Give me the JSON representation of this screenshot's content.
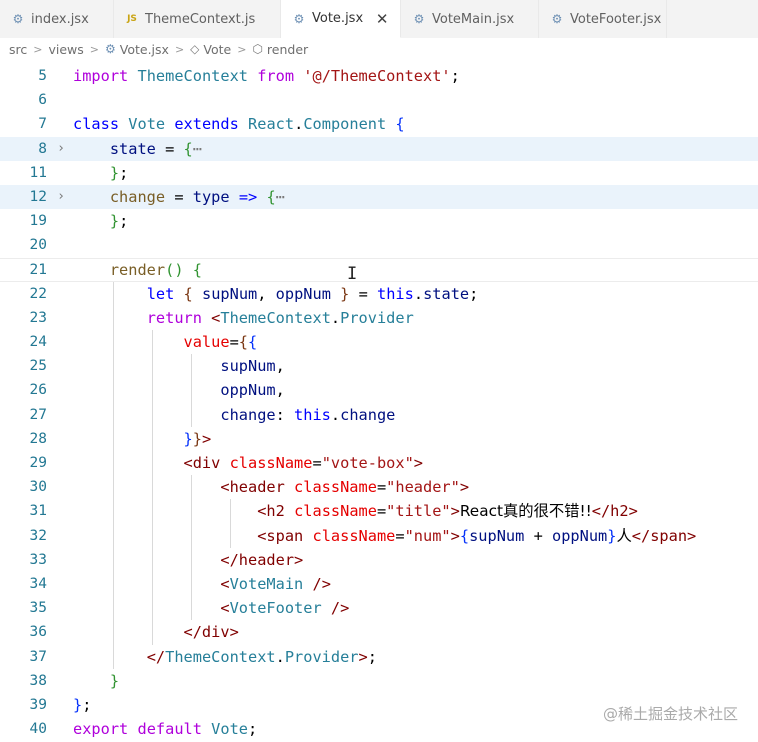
{
  "tabs": [
    {
      "label": "index.jsx",
      "icon": "gear-icon",
      "active": false
    },
    {
      "label": "ThemeContext.js",
      "icon": "js-file-icon",
      "active": false
    },
    {
      "label": "Vote.jsx",
      "icon": "gear-icon",
      "active": true
    },
    {
      "label": "VoteMain.jsx",
      "icon": "gear-icon",
      "active": false
    },
    {
      "label": "VoteFooter.jsx",
      "icon": "gear-icon",
      "active": false
    }
  ],
  "breadcrumb": {
    "src": "src",
    "views": "views",
    "file": "Vote.jsx",
    "class": "Vote",
    "method": "render"
  },
  "editor": {
    "lines": [
      {
        "num": "5",
        "fold": "",
        "tokens": [
          [
            "kw",
            "import"
          ],
          [
            "p",
            " "
          ],
          [
            "cls",
            "ThemeContext"
          ],
          [
            "p",
            " "
          ],
          [
            "kw",
            "from"
          ],
          [
            "p",
            " "
          ],
          [
            "str",
            "'@/ThemeContext'"
          ],
          [
            "p",
            ";"
          ]
        ]
      },
      {
        "num": "6",
        "fold": "",
        "tokens": []
      },
      {
        "num": "7",
        "fold": "",
        "tokens": [
          [
            "kw2",
            "class"
          ],
          [
            "p",
            " "
          ],
          [
            "cls",
            "Vote"
          ],
          [
            "p",
            " "
          ],
          [
            "kw2",
            "extends"
          ],
          [
            "p",
            " "
          ],
          [
            "cls",
            "React"
          ],
          [
            "p",
            "."
          ],
          [
            "cls",
            "Component"
          ],
          [
            "p",
            " "
          ],
          [
            "br1",
            "{"
          ]
        ]
      },
      {
        "num": "8",
        "fold": ">",
        "highlight": true,
        "tokens": [
          [
            "p",
            "    "
          ],
          [
            "var",
            "state"
          ],
          [
            "p",
            " = "
          ],
          [
            "br2",
            "{"
          ],
          [
            "ell",
            "⋯"
          ]
        ]
      },
      {
        "num": "11",
        "fold": "",
        "tokens": [
          [
            "p",
            "    "
          ],
          [
            "br2",
            "}"
          ],
          [
            "p",
            ";"
          ]
        ]
      },
      {
        "num": "12",
        "fold": ">",
        "highlight": true,
        "tokens": [
          [
            "p",
            "    "
          ],
          [
            "fn",
            "change"
          ],
          [
            "p",
            " = "
          ],
          [
            "var",
            "type"
          ],
          [
            "p",
            " "
          ],
          [
            "kw2",
            "=>"
          ],
          [
            "p",
            " "
          ],
          [
            "br2",
            "{"
          ],
          [
            "ell",
            "⋯"
          ]
        ]
      },
      {
        "num": "19",
        "fold": "",
        "tokens": [
          [
            "p",
            "    "
          ],
          [
            "br2",
            "}"
          ],
          [
            "p",
            ";"
          ]
        ]
      },
      {
        "num": "20",
        "fold": "",
        "tokens": []
      },
      {
        "num": "21",
        "fold": "",
        "current": true,
        "tokens": [
          [
            "p",
            "    "
          ],
          [
            "fn",
            "render"
          ],
          [
            "br2",
            "()"
          ],
          [
            "p",
            " "
          ],
          [
            "br2",
            "{"
          ]
        ]
      },
      {
        "num": "22",
        "fold": "",
        "tokens": [
          [
            "p",
            "        "
          ],
          [
            "kw2",
            "let"
          ],
          [
            "p",
            " "
          ],
          [
            "br3",
            "{"
          ],
          [
            "p",
            " "
          ],
          [
            "var",
            "supNum"
          ],
          [
            "p",
            ", "
          ],
          [
            "var",
            "oppNum"
          ],
          [
            "p",
            " "
          ],
          [
            "br3",
            "}"
          ],
          [
            "p",
            " = "
          ],
          [
            "kw2",
            "this"
          ],
          [
            "p",
            "."
          ],
          [
            "var",
            "state"
          ],
          [
            "p",
            ";"
          ]
        ]
      },
      {
        "num": "23",
        "fold": "",
        "tokens": [
          [
            "p",
            "        "
          ],
          [
            "kw",
            "return"
          ],
          [
            "p",
            " "
          ],
          [
            "tag",
            "<"
          ],
          [
            "cls",
            "ThemeContext"
          ],
          [
            "p",
            "."
          ],
          [
            "cls",
            "Provider"
          ]
        ]
      },
      {
        "num": "24",
        "fold": "",
        "tokens": [
          [
            "p",
            "            "
          ],
          [
            "attr",
            "value"
          ],
          [
            "p",
            "="
          ],
          [
            "br3",
            "{"
          ],
          [
            "br1",
            "{"
          ]
        ]
      },
      {
        "num": "25",
        "fold": "",
        "tokens": [
          [
            "p",
            "                "
          ],
          [
            "var",
            "supNum"
          ],
          [
            "p",
            ","
          ]
        ]
      },
      {
        "num": "26",
        "fold": "",
        "tokens": [
          [
            "p",
            "                "
          ],
          [
            "var",
            "oppNum"
          ],
          [
            "p",
            ","
          ]
        ]
      },
      {
        "num": "27",
        "fold": "",
        "tokens": [
          [
            "p",
            "                "
          ],
          [
            "var",
            "change"
          ],
          [
            "p",
            ": "
          ],
          [
            "kw2",
            "this"
          ],
          [
            "p",
            "."
          ],
          [
            "var",
            "change"
          ]
        ]
      },
      {
        "num": "28",
        "fold": "",
        "tokens": [
          [
            "p",
            "            "
          ],
          [
            "br1",
            "}"
          ],
          [
            "br3",
            "}"
          ],
          [
            "tag",
            ">"
          ]
        ]
      },
      {
        "num": "29",
        "fold": "",
        "tokens": [
          [
            "p",
            "            "
          ],
          [
            "tag",
            "<div"
          ],
          [
            "p",
            " "
          ],
          [
            "attr",
            "className"
          ],
          [
            "p",
            "="
          ],
          [
            "str",
            "\"vote-box\""
          ],
          [
            "tag",
            ">"
          ]
        ]
      },
      {
        "num": "30",
        "fold": "",
        "tokens": [
          [
            "p",
            "                "
          ],
          [
            "tag",
            "<header"
          ],
          [
            "p",
            " "
          ],
          [
            "attr",
            "className"
          ],
          [
            "p",
            "="
          ],
          [
            "str",
            "\"header\""
          ],
          [
            "tag",
            ">"
          ]
        ]
      },
      {
        "num": "31",
        "fold": "",
        "tokens": [
          [
            "p",
            "                    "
          ],
          [
            "tag",
            "<h2"
          ],
          [
            "p",
            " "
          ],
          [
            "attr",
            "className"
          ],
          [
            "p",
            "="
          ],
          [
            "str",
            "\"title\""
          ],
          [
            "tag",
            ">"
          ],
          [
            "txt",
            "React真的很不错!!"
          ],
          [
            "tag",
            "</h2>"
          ]
        ]
      },
      {
        "num": "32",
        "fold": "",
        "tokens": [
          [
            "p",
            "                    "
          ],
          [
            "tag",
            "<span"
          ],
          [
            "p",
            " "
          ],
          [
            "attr",
            "className"
          ],
          [
            "p",
            "="
          ],
          [
            "str",
            "\"num\""
          ],
          [
            "tag",
            ">"
          ],
          [
            "br1",
            "{"
          ],
          [
            "var",
            "supNum"
          ],
          [
            "p",
            " + "
          ],
          [
            "var",
            "oppNum"
          ],
          [
            "br1",
            "}"
          ],
          [
            "txt",
            "人"
          ],
          [
            "tag",
            "</span>"
          ]
        ]
      },
      {
        "num": "33",
        "fold": "",
        "tokens": [
          [
            "p",
            "                "
          ],
          [
            "tag",
            "</header>"
          ]
        ]
      },
      {
        "num": "34",
        "fold": "",
        "tokens": [
          [
            "p",
            "                "
          ],
          [
            "tag",
            "<"
          ],
          [
            "cls",
            "VoteMain"
          ],
          [
            "p",
            " "
          ],
          [
            "tag",
            "/>"
          ]
        ]
      },
      {
        "num": "35",
        "fold": "",
        "tokens": [
          [
            "p",
            "                "
          ],
          [
            "tag",
            "<"
          ],
          [
            "cls",
            "VoteFooter"
          ],
          [
            "p",
            " "
          ],
          [
            "tag",
            "/>"
          ]
        ]
      },
      {
        "num": "36",
        "fold": "",
        "tokens": [
          [
            "p",
            "            "
          ],
          [
            "tag",
            "</div>"
          ]
        ]
      },
      {
        "num": "37",
        "fold": "",
        "tokens": [
          [
            "p",
            "        "
          ],
          [
            "tag",
            "</"
          ],
          [
            "cls",
            "ThemeContext"
          ],
          [
            "p",
            "."
          ],
          [
            "cls",
            "Provider"
          ],
          [
            "tag",
            ">"
          ],
          [
            "p",
            ";"
          ]
        ]
      },
      {
        "num": "38",
        "fold": "",
        "tokens": [
          [
            "p",
            "    "
          ],
          [
            "br2",
            "}"
          ]
        ]
      },
      {
        "num": "39",
        "fold": "",
        "tokens": [
          [
            "br1",
            "}"
          ],
          [
            "p",
            ";"
          ]
        ]
      },
      {
        "num": "40",
        "fold": "",
        "tokens": [
          [
            "kw",
            "export"
          ],
          [
            "p",
            " "
          ],
          [
            "kw",
            "default"
          ],
          [
            "p",
            " "
          ],
          [
            "cls",
            "Vote"
          ],
          [
            "p",
            ";"
          ]
        ]
      }
    ]
  },
  "watermark": "@稀土掘金技术社区",
  "colors": {
    "line_number": "#237893",
    "keyword_control": "#af00db",
    "keyword": "#0000ff",
    "class_name": "#267f99",
    "variable": "#001080",
    "function": "#795e26",
    "string": "#a31515",
    "tag": "#800000",
    "attribute": "#e50000",
    "folded_line_highlight": "#eaf3fb"
  }
}
